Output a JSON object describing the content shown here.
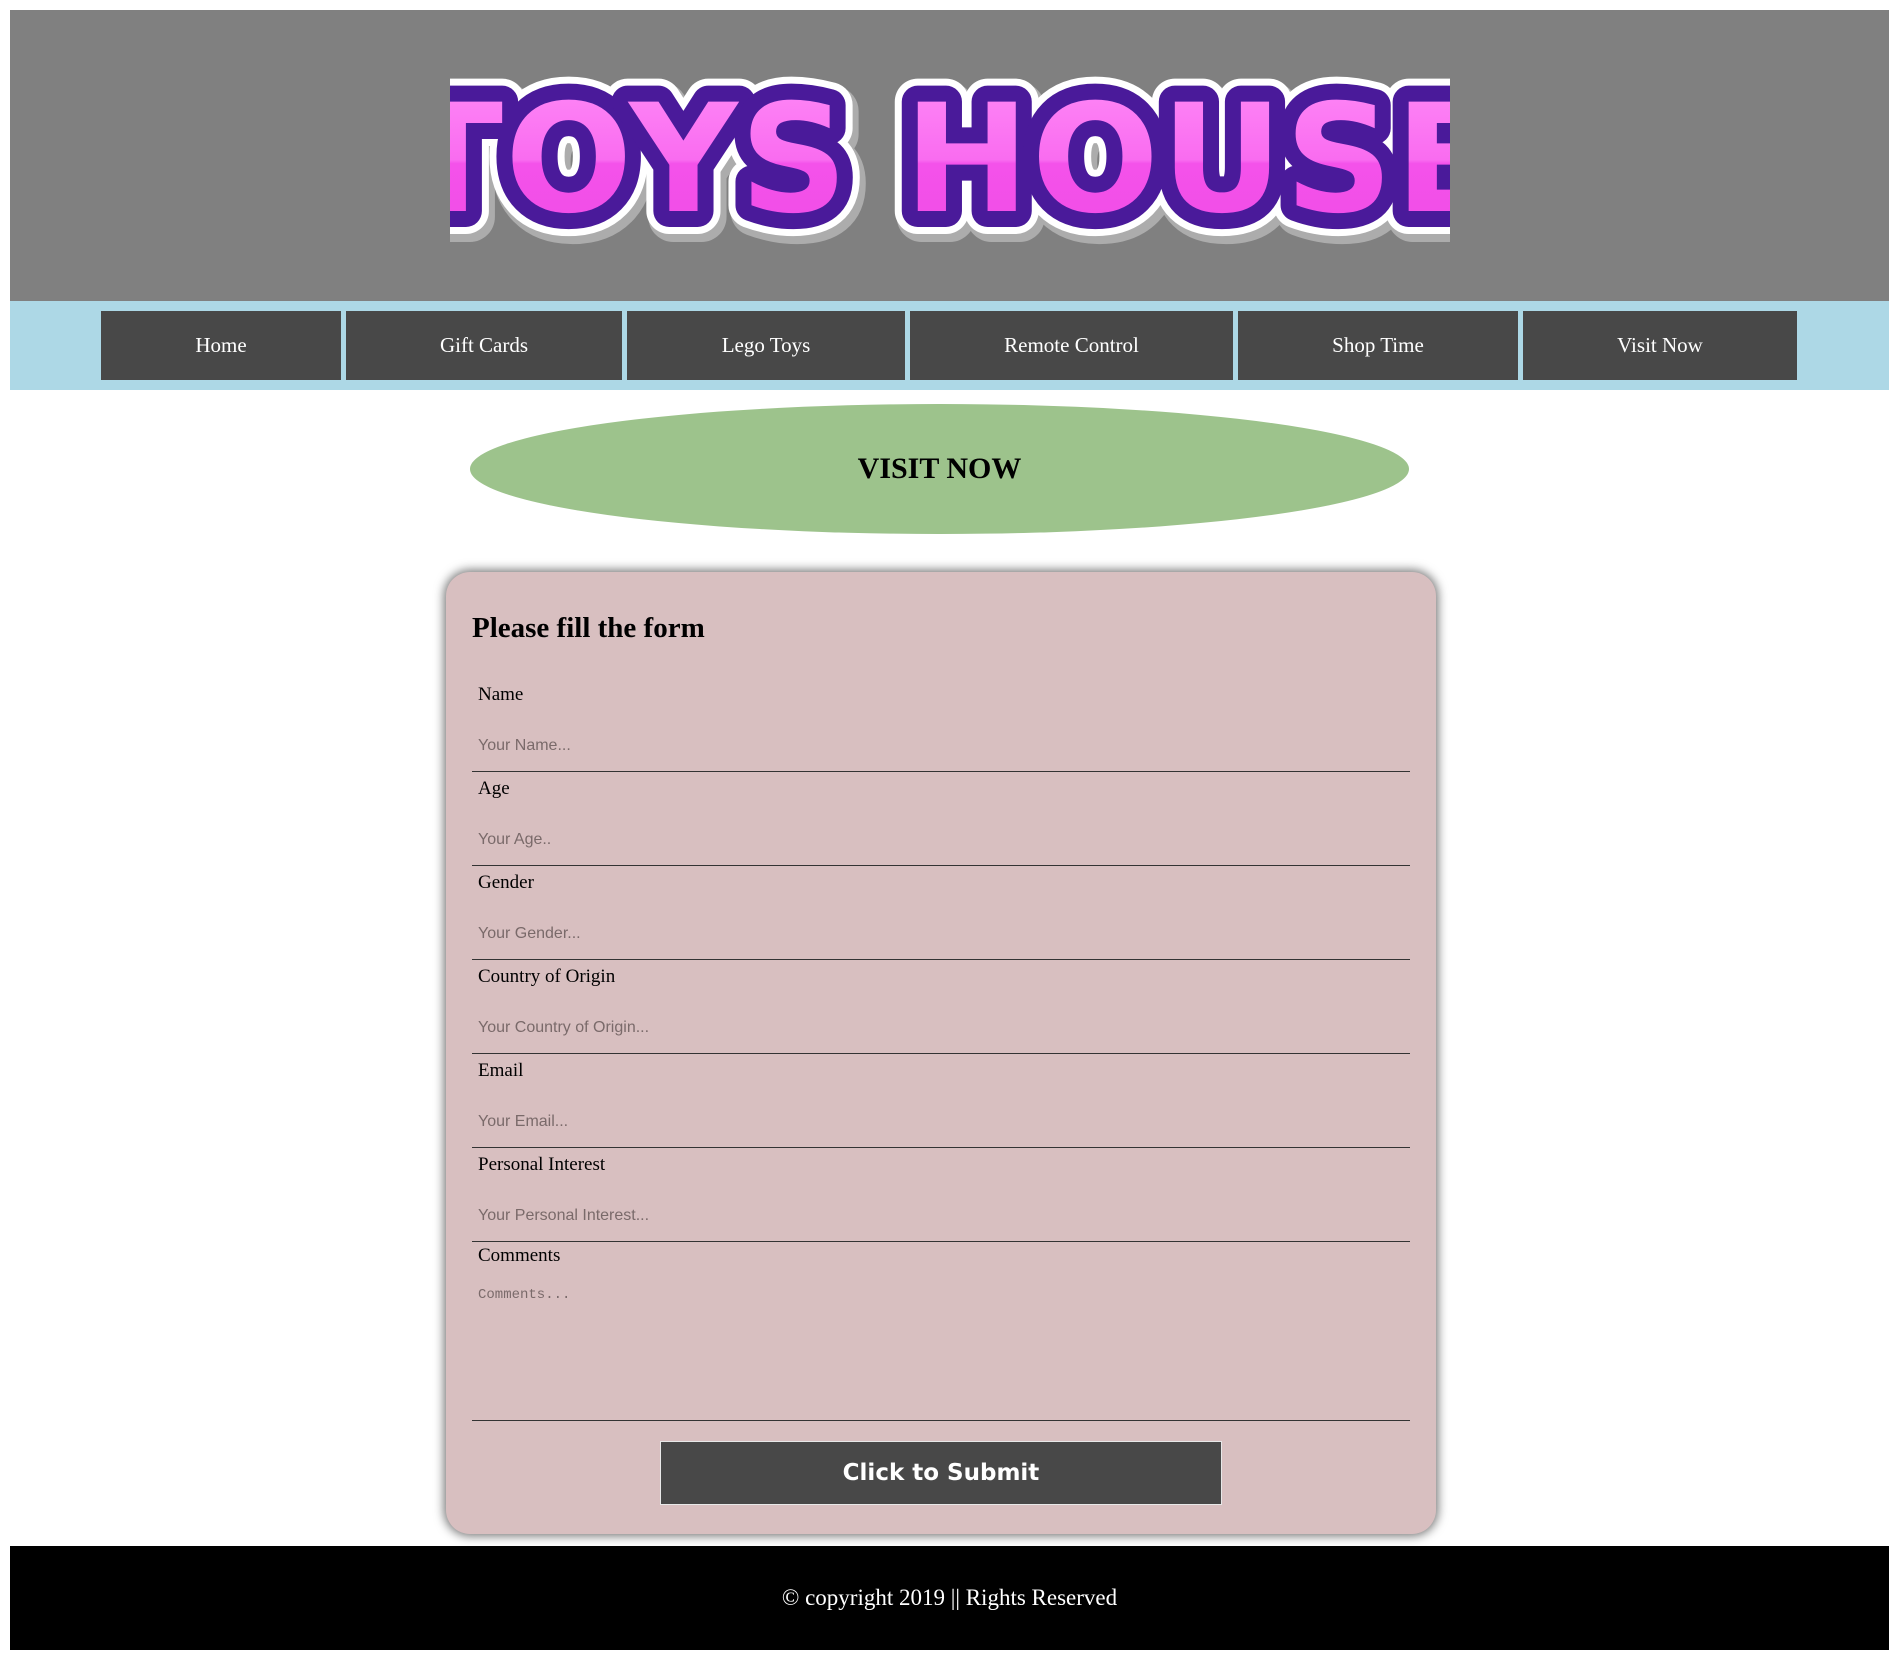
{
  "header": {
    "logo_text": "TOYS HOUSE",
    "background": "#808080"
  },
  "nav": {
    "background": "#add8e6",
    "items": [
      {
        "label": "Home"
      },
      {
        "label": "Gift Cards"
      },
      {
        "label": "Lego Toys"
      },
      {
        "label": "Remote Control"
      },
      {
        "label": "Shop Time"
      },
      {
        "label": "Visit Now"
      }
    ]
  },
  "banner": {
    "text": "VISIT NOW",
    "color": "#9dc38c"
  },
  "form": {
    "title": "Please fill the form",
    "background": "#d8bfc0",
    "fields": [
      {
        "label": "Name",
        "placeholder": "Your Name..."
      },
      {
        "label": "Age",
        "placeholder": "Your Age.."
      },
      {
        "label": "Gender",
        "placeholder": "Your Gender..."
      },
      {
        "label": "Country of Origin",
        "placeholder": "Your Country of Origin..."
      },
      {
        "label": "Email",
        "placeholder": "Your Email..."
      },
      {
        "label": "Personal Interest",
        "placeholder": "Your Personal Interest..."
      }
    ],
    "comments": {
      "label": "Comments",
      "placeholder": "Comments..."
    },
    "submit_label": "Click to Submit"
  },
  "footer": {
    "text": "© copyright 2019 || Rights Reserved"
  }
}
